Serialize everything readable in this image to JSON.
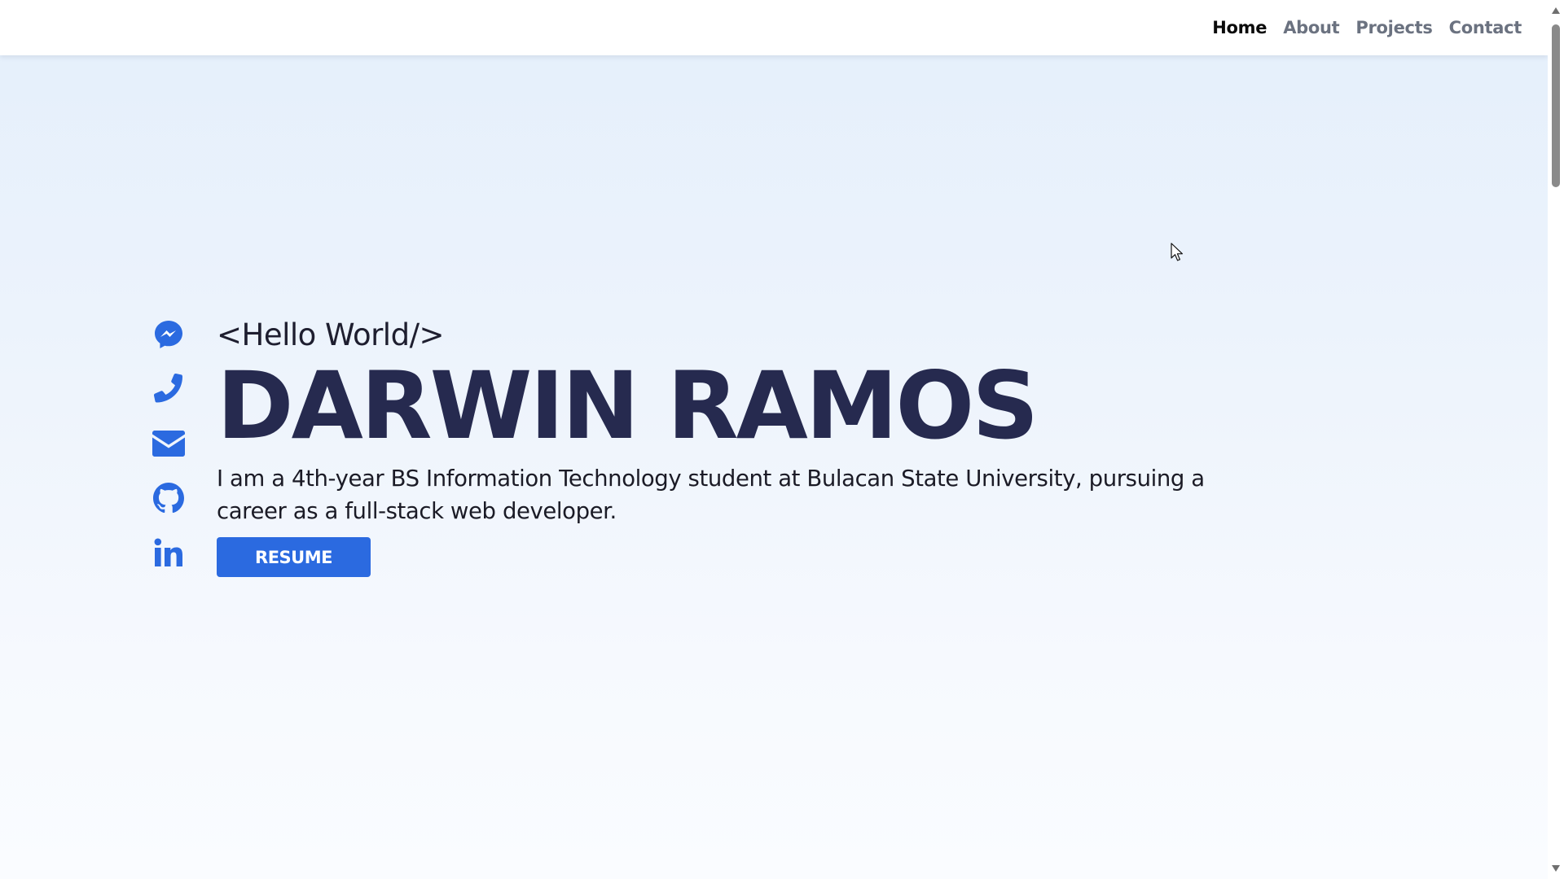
{
  "nav": {
    "items": [
      {
        "label": "Home",
        "active": true
      },
      {
        "label": "About",
        "active": false
      },
      {
        "label": "Projects",
        "active": false
      },
      {
        "label": "Contact",
        "active": false
      }
    ]
  },
  "social": {
    "icons": [
      "messenger-icon",
      "phone-icon",
      "email-icon",
      "github-icon",
      "linkedin-icon"
    ],
    "color": "#2b6ae0"
  },
  "hero": {
    "greeting": "<Hello World/>",
    "name": "DARWIN RAMOS",
    "description": "I am a 4th-year BS Information Technology student at Bulacan State University, pursuing a career as a full-stack web developer.",
    "resume_label": "RESUME"
  },
  "colors": {
    "accent": "#2b6ae0",
    "name_text": "#262a4f",
    "nav_active": "#0b0b0b",
    "nav_inactive": "#6b7280"
  }
}
